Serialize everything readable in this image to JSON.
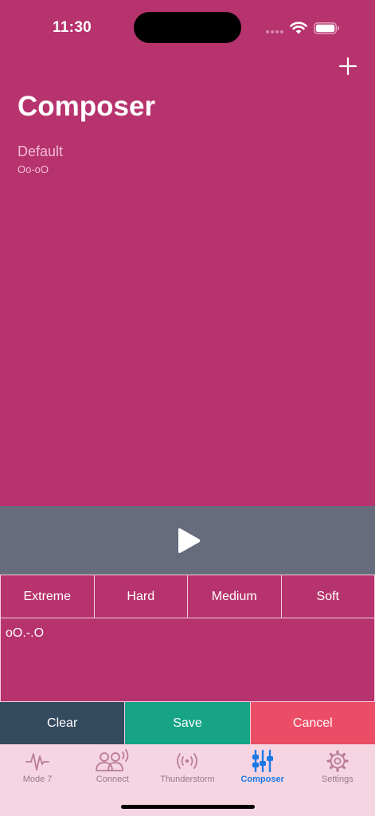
{
  "status_bar": {
    "time": "11:30"
  },
  "header": {
    "title": "Composer",
    "add_icon": "plus-icon"
  },
  "patterns": [
    {
      "name": "Default",
      "sequence": "Oo-oO"
    }
  ],
  "player": {
    "icon": "play-icon"
  },
  "intensity": [
    {
      "label": "Extreme"
    },
    {
      "label": "Hard"
    },
    {
      "label": "Medium"
    },
    {
      "label": "Soft"
    }
  ],
  "editor": {
    "value": "oO.-.O"
  },
  "actions": {
    "clear": "Clear",
    "save": "Save",
    "cancel": "Cancel"
  },
  "tabs": [
    {
      "label": "Mode 7",
      "icon": "waveform-icon"
    },
    {
      "label": "Connect",
      "icon": "people-broadcast-icon"
    },
    {
      "label": "Thunderstorm",
      "icon": "broadcast-icon"
    },
    {
      "label": "Composer",
      "icon": "sliders-icon",
      "active": true
    },
    {
      "label": "Settings",
      "icon": "gear-icon"
    }
  ],
  "colors": {
    "background": "#b7336d",
    "play_bar": "#666c7c",
    "clear": "#344a5e",
    "save": "#16a386",
    "cancel": "#eb4d66",
    "tab_bar": "#f6d5e2",
    "tab_active": "#1b79e6"
  }
}
